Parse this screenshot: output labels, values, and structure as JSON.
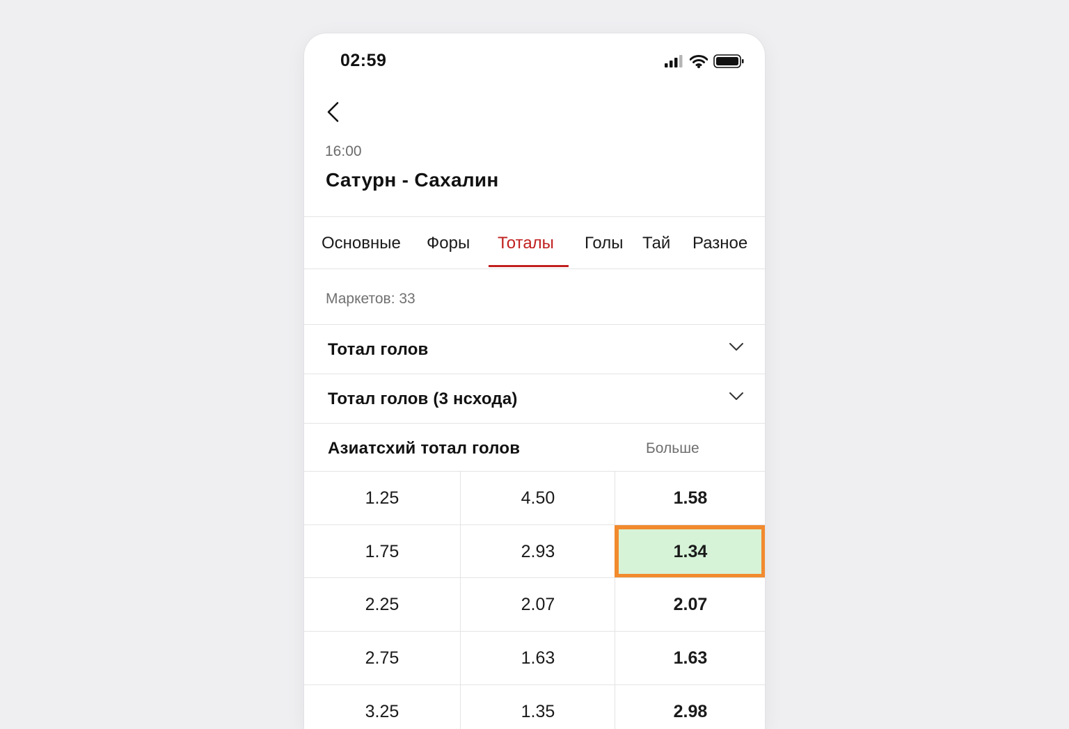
{
  "status_bar": {
    "time": "02:59",
    "icons": [
      "signal-icon",
      "wifi-icon",
      "battery-icon"
    ]
  },
  "header": {
    "back_icon": "chevron-left-icon",
    "match_time": "16:00",
    "match_title": "Сатурн - Сахалин"
  },
  "tabs": [
    {
      "label": "Основные",
      "active": false
    },
    {
      "label": "Форы",
      "active": false
    },
    {
      "label": "Тоталы",
      "active": true
    },
    {
      "label": "Голы",
      "active": false
    },
    {
      "label": "Тай",
      "active": false
    },
    {
      "label": "Разное",
      "active": false
    }
  ],
  "markets_count": "Маркетов: 33",
  "sections": [
    {
      "title": "Тотал голов",
      "icon": "chevron-down-icon",
      "expanded": false
    },
    {
      "title": "Тотал голов (3 нсхода)",
      "icon": "chevron-down-icon",
      "expanded": false
    },
    {
      "title": "Азиатсхий тотал голов",
      "column_header": "Больше",
      "expanded": true
    }
  ],
  "asian_total_rows": [
    {
      "total": "1.25",
      "under": "4.50",
      "over": "1.58",
      "selected": false
    },
    {
      "total": "1.75",
      "under": "2.93",
      "over": "1.34",
      "selected": true
    },
    {
      "total": "2.25",
      "under": "2.07",
      "over": "2.07",
      "selected": false
    },
    {
      "total": "2.75",
      "under": "1.63",
      "over": "1.63",
      "selected": false
    },
    {
      "total": "3.25",
      "under": "1.35",
      "over": "2.98",
      "selected": false
    }
  ],
  "colors": {
    "accent": "#c0201f",
    "selected_fill": "#d6f3d8",
    "selected_outline": "#f28a2e",
    "divider": "#e4e4e4"
  }
}
